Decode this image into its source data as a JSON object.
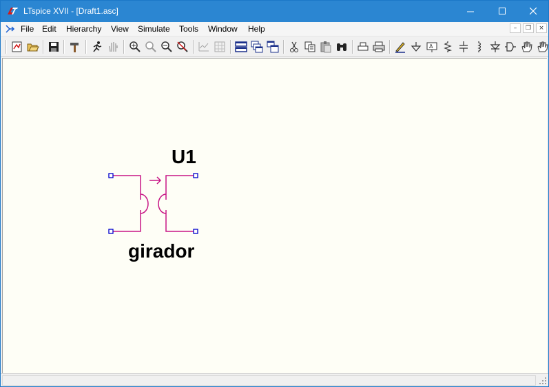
{
  "window": {
    "title": "LTspice XVII - [Draft1.asc]",
    "minimize_glyph": "─",
    "maximize_glyph": "☐",
    "close_glyph": "✕"
  },
  "menu": {
    "items": [
      "File",
      "Edit",
      "Hierarchy",
      "View",
      "Simulate",
      "Tools",
      "Window",
      "Help"
    ],
    "mdi_minimize": "–",
    "mdi_restore": "❐",
    "mdi_close": "×"
  },
  "toolbar": {
    "buttons": [
      {
        "icon": "new-schematic-icon"
      },
      {
        "icon": "open-icon"
      },
      {
        "icon": "save-icon"
      },
      {
        "icon": "control-panel-hammer-icon"
      },
      {
        "icon": "run-icon"
      },
      {
        "icon": "halt-hand-icon"
      },
      {
        "icon": "zoom-in-icon"
      },
      {
        "icon": "zoom-pan-icon"
      },
      {
        "icon": "zoom-out-icon"
      },
      {
        "icon": "zoom-fit-icon"
      },
      {
        "icon": "autorange-icon"
      },
      {
        "icon": "grid-icon"
      },
      {
        "icon": "tile-horizontal-icon"
      },
      {
        "icon": "cascade-icon"
      },
      {
        "icon": "tile-vertical-icon"
      },
      {
        "icon": "cut-icon"
      },
      {
        "icon": "copy-icon"
      },
      {
        "icon": "paste-icon"
      },
      {
        "icon": "find-icon"
      },
      {
        "icon": "print-setup-icon"
      },
      {
        "icon": "print-icon"
      },
      {
        "icon": "draw-wire-icon"
      },
      {
        "icon": "ground-icon"
      },
      {
        "icon": "label-net-icon"
      },
      {
        "icon": "resistor-icon"
      },
      {
        "icon": "capacitor-icon"
      },
      {
        "icon": "inductor-icon"
      },
      {
        "icon": "diode-icon"
      },
      {
        "icon": "component-icon"
      },
      {
        "icon": "move-hand-icon"
      },
      {
        "icon": "drag-hand-icon"
      }
    ]
  },
  "colors": {
    "titlebar": "#2b86d2",
    "canvas": "#fefef6",
    "wire": "#c71585",
    "pin": "#0000cc"
  },
  "schematic": {
    "instance_name": "U1",
    "value_name": "girador"
  }
}
